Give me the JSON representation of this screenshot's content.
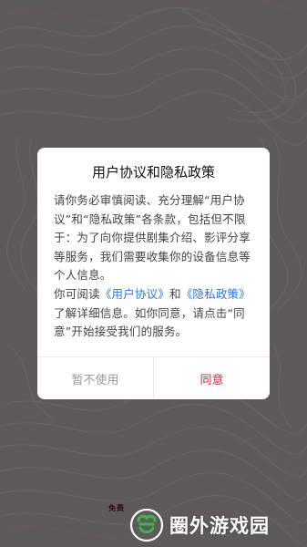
{
  "dialog": {
    "title": "用户协议和隐私政策",
    "paragraph1": "请你务必审慎阅读、充分理解“用户协议”和“隐私政策”各条款，包括但不限于：为了向你提供剧集介绍、影评分享等服务，我们需要收集你的设备信息等个人信息。",
    "paragraph2_prefix": "你可阅读",
    "user_agreement_link": "《用户协议》",
    "and_text": "和",
    "privacy_policy_link": "《隐私政策》",
    "paragraph2_suffix": "了解详细信息。如你同意，请点击“同意”开始接受我们的服务。",
    "cancel_label": "暂不使用",
    "agree_label": "同意"
  },
  "footer": {
    "partial_text": "免费"
  },
  "watermark": {
    "text": "圈外游戏园",
    "logo_icon": "app-logo-icon"
  },
  "colors": {
    "link": "#2f78d8",
    "agree": "#d1263b",
    "overlay": "#5e5a5a"
  }
}
